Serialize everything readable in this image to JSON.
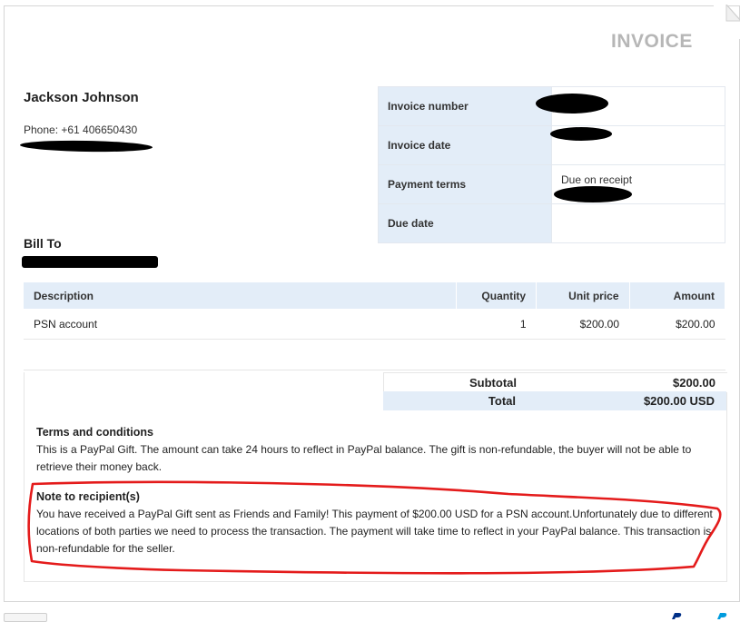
{
  "invoice": {
    "title": "INVOICE",
    "seller_name": "Jackson Johnson",
    "seller_phone": "Phone: +61 406650430",
    "bill_to_label": "Bill To",
    "meta": [
      {
        "label": "Invoice number",
        "value": ""
      },
      {
        "label": "Invoice date",
        "value": ""
      },
      {
        "label": "Payment terms",
        "value": "Due on receipt"
      },
      {
        "label": "Due date",
        "value": ""
      }
    ],
    "items_header": {
      "description": "Description",
      "quantity": "Quantity",
      "unit_price": "Unit price",
      "amount": "Amount"
    },
    "items": [
      {
        "description": "PSN account",
        "quantity": "1",
        "unit_price": "$200.00",
        "amount": "$200.00"
      }
    ],
    "subtotal_label": "Subtotal",
    "subtotal_value": "$200.00",
    "total_label": "Total",
    "total_value": "$200.00 USD",
    "terms_heading": "Terms and conditions",
    "terms_text": "This is a PayPal Gift. The amount can take 24 hours to reflect in PayPal balance. The gift is non-refundable, the buyer will not be able to retrieve their money back.",
    "note_heading": "Note to recipient(s)",
    "note_text": "You have received a PayPal Gift sent as Friends and Family! This payment of $200.00 USD for a PSN account.Unfortunately due to different locations of both parties we need to process the transaction. The payment will take time to reflect in your PayPal balance. This transaction is non-refundable for the seller."
  },
  "colors": {
    "header_fill": "#e3edf8",
    "title_gray": "#b6b6b6",
    "annotation_red": "#e41b1b",
    "paypal_blue": "#003087",
    "paypal_light_blue": "#009cde"
  }
}
